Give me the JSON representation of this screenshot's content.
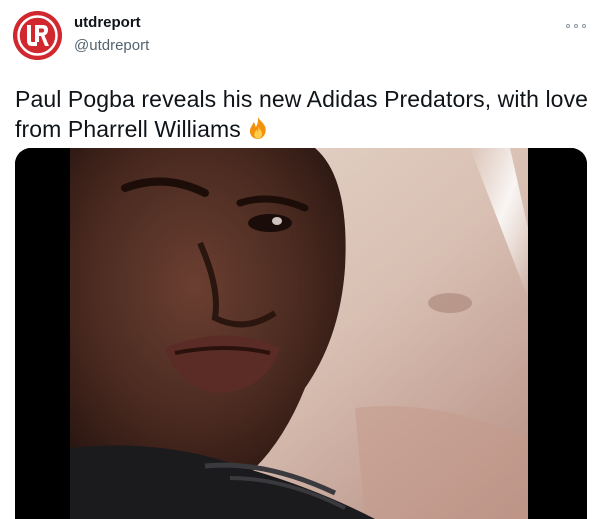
{
  "tweet": {
    "avatar_icon": "utdreport-logo-icon",
    "display_name": "utdreport",
    "handle": "@utdreport",
    "more_icon": "more-options-icon",
    "text": "Paul Pogba reveals his new Adidas Predators, with love from Pharrell Williams",
    "emoji_icon": "fire-emoji-icon",
    "media_type": "video"
  },
  "colors": {
    "brand_red": "#d0282e",
    "handle_gray": "#536471",
    "text": "#0f1419"
  }
}
